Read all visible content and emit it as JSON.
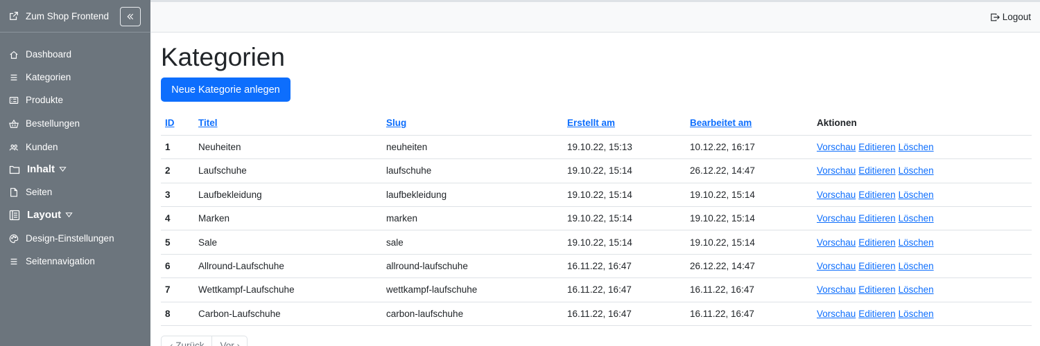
{
  "sidebar": {
    "shop_link": "Zum Shop Frontend",
    "items": [
      {
        "label": "Dashboard",
        "icon": "house-icon"
      },
      {
        "label": "Kategorien",
        "icon": "list-icon"
      },
      {
        "label": "Produkte",
        "icon": "card-list-icon"
      },
      {
        "label": "Bestellungen",
        "icon": "basket-icon"
      },
      {
        "label": "Kunden",
        "icon": "people-icon"
      },
      {
        "label": "Inhalt",
        "icon": "folder-icon"
      },
      {
        "label": "Seiten",
        "icon": "file-icon"
      },
      {
        "label": "Layout",
        "icon": "layout-icon"
      },
      {
        "label": "Design-Einstellungen",
        "icon": "palette-icon"
      },
      {
        "label": "Seitennavigation",
        "icon": "list-icon"
      }
    ]
  },
  "topbar": {
    "logout": "Logout"
  },
  "page": {
    "title": "Kategorien",
    "new_button": "Neue Kategorie anlegen"
  },
  "table": {
    "headers": {
      "id": "ID",
      "title": "Titel",
      "slug": "Slug",
      "created": "Erstellt am",
      "edited": "Bearbeitet am",
      "actions": "Aktionen"
    },
    "action_labels": {
      "preview": "Vorschau",
      "edit": "Editieren",
      "delete": "Löschen"
    },
    "rows": [
      {
        "id": "1",
        "title": "Neuheiten",
        "slug": "neuheiten",
        "created": "19.10.22, 15:13",
        "edited": "10.12.22, 16:17"
      },
      {
        "id": "2",
        "title": "Laufschuhe",
        "slug": "laufschuhe",
        "created": "19.10.22, 15:14",
        "edited": "26.12.22, 14:47"
      },
      {
        "id": "3",
        "title": "Laufbekleidung",
        "slug": "laufbekleidung",
        "created": "19.10.22, 15:14",
        "edited": "19.10.22, 15:14"
      },
      {
        "id": "4",
        "title": "Marken",
        "slug": "marken",
        "created": "19.10.22, 15:14",
        "edited": "19.10.22, 15:14"
      },
      {
        "id": "5",
        "title": "Sale",
        "slug": "sale",
        "created": "19.10.22, 15:14",
        "edited": "19.10.22, 15:14"
      },
      {
        "id": "6",
        "title": "Allround-Laufschuhe",
        "slug": "allround-laufschuhe",
        "created": "16.11.22, 16:47",
        "edited": "26.12.22, 14:47"
      },
      {
        "id": "7",
        "title": "Wettkampf-Laufschuhe",
        "slug": "wettkampf-laufschuhe",
        "created": "16.11.22, 16:47",
        "edited": "16.11.22, 16:47"
      },
      {
        "id": "8",
        "title": "Carbon-Laufschuhe",
        "slug": "carbon-laufschuhe",
        "created": "16.11.22, 16:47",
        "edited": "16.11.22, 16:47"
      }
    ]
  },
  "pagination": {
    "prev": "‹ Zurück",
    "next": "Vor ›"
  },
  "colors": {
    "sidebar": "#6c757d",
    "primary": "#0d6efd",
    "topbar": "#f8f9fa"
  }
}
